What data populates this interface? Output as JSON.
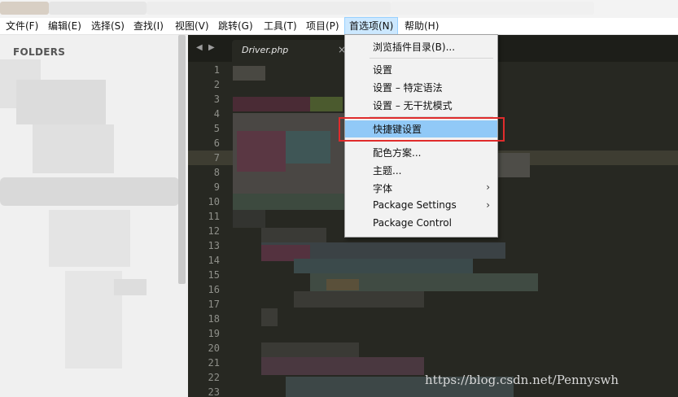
{
  "menubar": {
    "items": [
      {
        "label": "文件(F)"
      },
      {
        "label": "编辑(E)"
      },
      {
        "label": "选择(S)"
      },
      {
        "label": "查找(I)"
      },
      {
        "label": "视图(V)"
      },
      {
        "label": "跳转(G)"
      },
      {
        "label": "工具(T)"
      },
      {
        "label": "项目(P)"
      },
      {
        "label": "首选项(N)"
      },
      {
        "label": "帮助(H)"
      }
    ]
  },
  "sidebar": {
    "title": "FOLDERS"
  },
  "editor": {
    "tab": {
      "filename": "Driver.php",
      "close_glyph": "×"
    },
    "nav_left": "◀",
    "nav_right": "▶",
    "line_numbers": [
      "1",
      "2",
      "3",
      "4",
      "5",
      "6",
      "7",
      "8",
      "9",
      "10",
      "11",
      "12",
      "13",
      "14",
      "15",
      "16",
      "17",
      "18",
      "19",
      "20",
      "21",
      "22",
      "23"
    ],
    "highlighted_line": "7"
  },
  "dropdown": {
    "items": [
      {
        "label": "浏览插件目录(B)..."
      },
      {
        "label": "设置"
      },
      {
        "label": "设置 – 特定语法"
      },
      {
        "label": "设置 – 无干扰模式"
      },
      {
        "label": "快捷键设置",
        "selected": true
      },
      {
        "label": "配色方案..."
      },
      {
        "label": "主题..."
      },
      {
        "label": "字体",
        "submenu": true
      },
      {
        "label": "Package Settings",
        "submenu": true
      },
      {
        "label": "Package Control"
      }
    ],
    "submenu_glyph": "›"
  },
  "watermark": "https://blog.csdn.net/Pennyswh",
  "colors": {
    "editor_bg": "#272822",
    "sidebar_bg": "#f0f0f0",
    "selection": "#91c9f7",
    "annotation_box": "#e02c2c"
  }
}
